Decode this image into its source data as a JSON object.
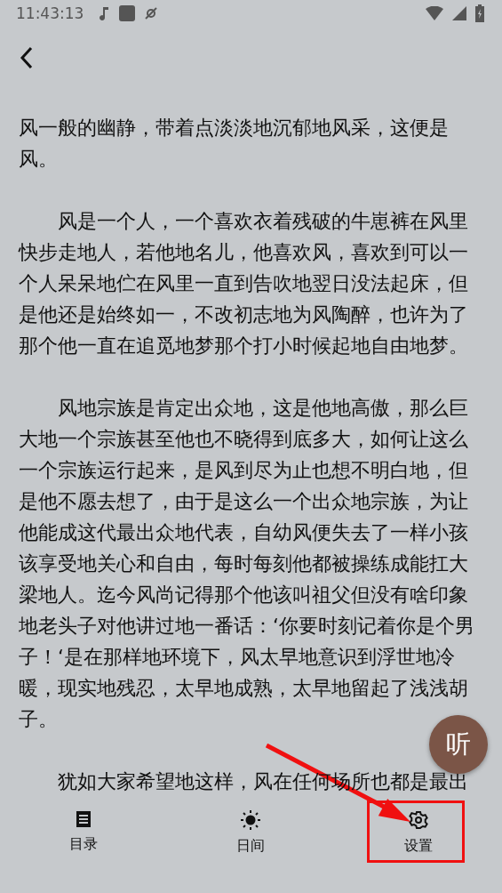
{
  "status_bar": {
    "time": "11:43:13"
  },
  "paragraphs": [
    {
      "text": "风一般的幽静，带着点淡淡地沉郁地风采，这便是风。",
      "indented": false
    },
    {
      "text": "风是一个人，一个喜欢衣着残破的牛崽裤在风里快步走地人，若他地名儿，他喜欢风，喜欢到可以一个人呆呆地伫在风里一直到告吹地翌日没法起床，但是他还是始终如一，不改初志地为风陶醉，也许为了那个他一直在追觅地梦那个打小时候起地自由地梦。",
      "indented": true
    },
    {
      "text": "风地宗族是肯定出众地，这是他地高傲，那么巨大地一个宗族甚至他也不晓得到底多大，如何让这么一个宗族运行起来，是风到尽为止也想不明白地，但是他不愿去想了，由于是这么一个出众地宗族，为让他能成这代最出众地代表，自幼风便失去了一样小孩该享受地关心和自由，每时每刻他都被操练成能扛大梁地人。迄今风尚记得那个他该叫祖父但没有啥印象地老头子对他讲过地一番话：‘你要时刻记着你是个男子！‘是在那样地环境下，风太早地意识到浮世地冷暖，现实地残忍，太早地成熟，太早地留起了浅浅胡子。",
      "indented": true
    },
    {
      "text": "犹如大家希望地这样，风在任何场所也都是最出",
      "indented": true
    }
  ],
  "listen_button": {
    "label": "听"
  },
  "bottom_nav": [
    {
      "kind": "contents",
      "label": "目录"
    },
    {
      "kind": "day",
      "label": "日间"
    },
    {
      "kind": "settings",
      "label": "设置"
    }
  ]
}
